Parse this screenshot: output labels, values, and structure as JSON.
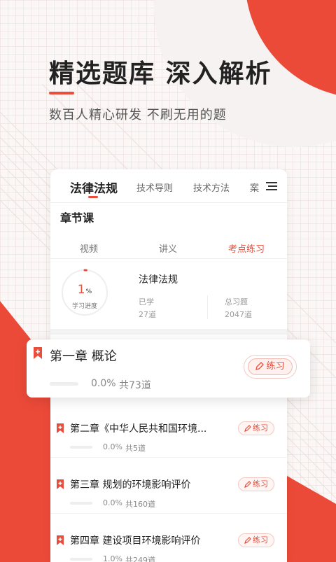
{
  "headline": "精选题库 深入解析",
  "subtitle": "数百人精心研发 不刷无用的题",
  "colors": {
    "accent": "#e94e3d",
    "background": "#fbf7f6"
  },
  "tabs": [
    {
      "label": "法律法规",
      "active": true
    },
    {
      "label": "技术导则",
      "active": false
    },
    {
      "label": "技术方法",
      "active": false
    },
    {
      "label": "案",
      "active": false
    }
  ],
  "section_title": "章节课",
  "subtabs": [
    {
      "label": "视频",
      "active": false
    },
    {
      "label": "讲义",
      "active": false
    },
    {
      "label": "考点练习",
      "active": true
    }
  ],
  "overview": {
    "progress_value": "1",
    "progress_unit": "%",
    "progress_fraction": 0.01,
    "progress_label": "学习进度",
    "subject": "法律法规",
    "learned_label": "已学",
    "learned_value": "27道",
    "total_label": "总习题",
    "total_value": "2047道"
  },
  "featured_chapter": {
    "title": "第一章 概论",
    "percent": "0.0%",
    "count": "共73道",
    "button": "练习"
  },
  "chapters": [
    {
      "title": "第二章《中华人民共和国环境...",
      "percent": "0.0%",
      "count": "共5道",
      "button": "练习"
    },
    {
      "title": "第三章 规划的环境影响评价",
      "percent": "0.0%",
      "count": "共160道",
      "button": "练习"
    },
    {
      "title": "第四章 建设项目环境影响评价",
      "percent": "1.0%",
      "count": "共249道",
      "button": "练习"
    }
  ],
  "icons": [
    "menu-icon",
    "bookmark-icon",
    "pencil-icon"
  ]
}
